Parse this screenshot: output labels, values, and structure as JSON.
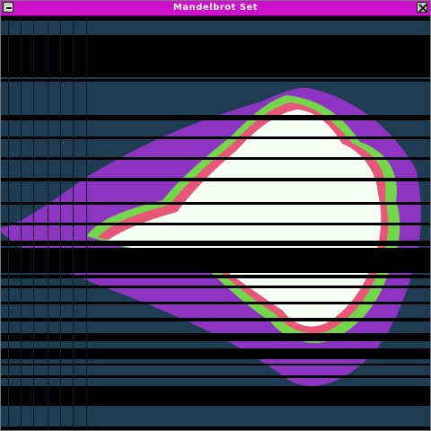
{
  "window": {
    "title": "Mandelbrot Set"
  },
  "colors": {
    "titlebar": "#cc10cc",
    "background": "#1e3d52",
    "band_black": "#000000",
    "set_interior": "#f6fff6",
    "escape_outer": "#8e34c2",
    "escape_mid": "#74d64a",
    "escape_inner": "#e8577a"
  },
  "icons": {
    "system_menu": "system-menu-icon",
    "close": "close-icon"
  }
}
